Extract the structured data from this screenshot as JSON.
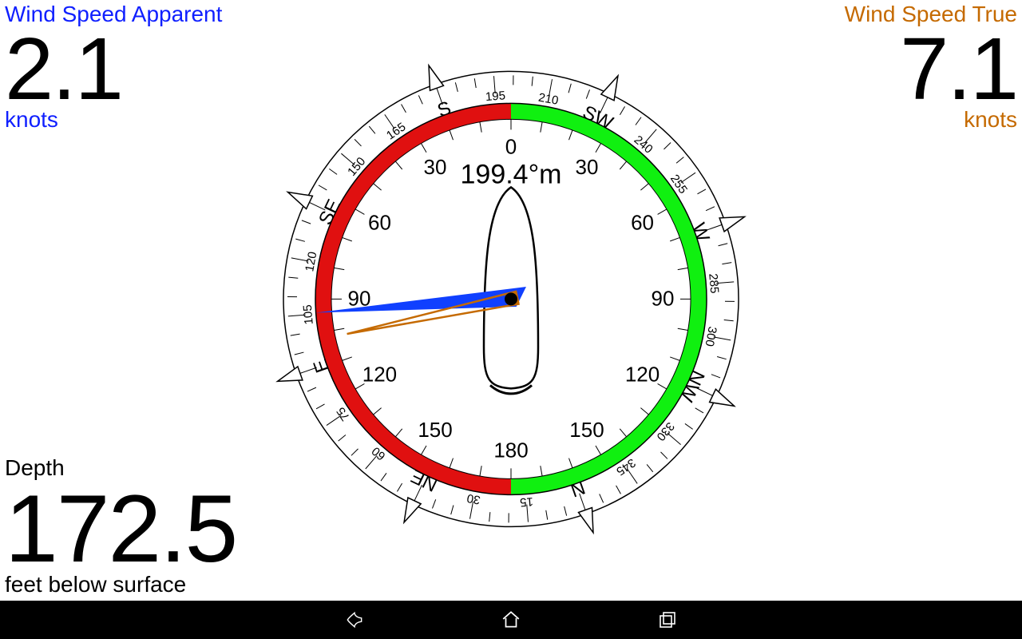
{
  "wind_apparent": {
    "title": "Wind Speed Apparent",
    "value": "2.1",
    "unit": "knots"
  },
  "wind_true": {
    "title": "Wind Speed True",
    "value": "7.1",
    "unit": "knots"
  },
  "depth": {
    "title": "Depth",
    "value": "172.5",
    "unit": "feet below surface"
  },
  "compass": {
    "heading_text": "199.4°m",
    "heading_deg": 199.4,
    "wind_true_angle_deg": -102,
    "wind_apparent_angle_deg": -94,
    "inner_labels": [
      "0",
      "30",
      "60",
      "90",
      "120",
      "150",
      "180",
      "150",
      "120",
      "90",
      "60",
      "30"
    ],
    "port_color": "#e01010",
    "starboard_color": "#10f010",
    "cardinals": [
      "N",
      "NE",
      "E",
      "SE",
      "S",
      "SW",
      "W",
      "NW"
    ]
  },
  "nav": {
    "back": "back",
    "home": "home",
    "recent": "recent"
  }
}
